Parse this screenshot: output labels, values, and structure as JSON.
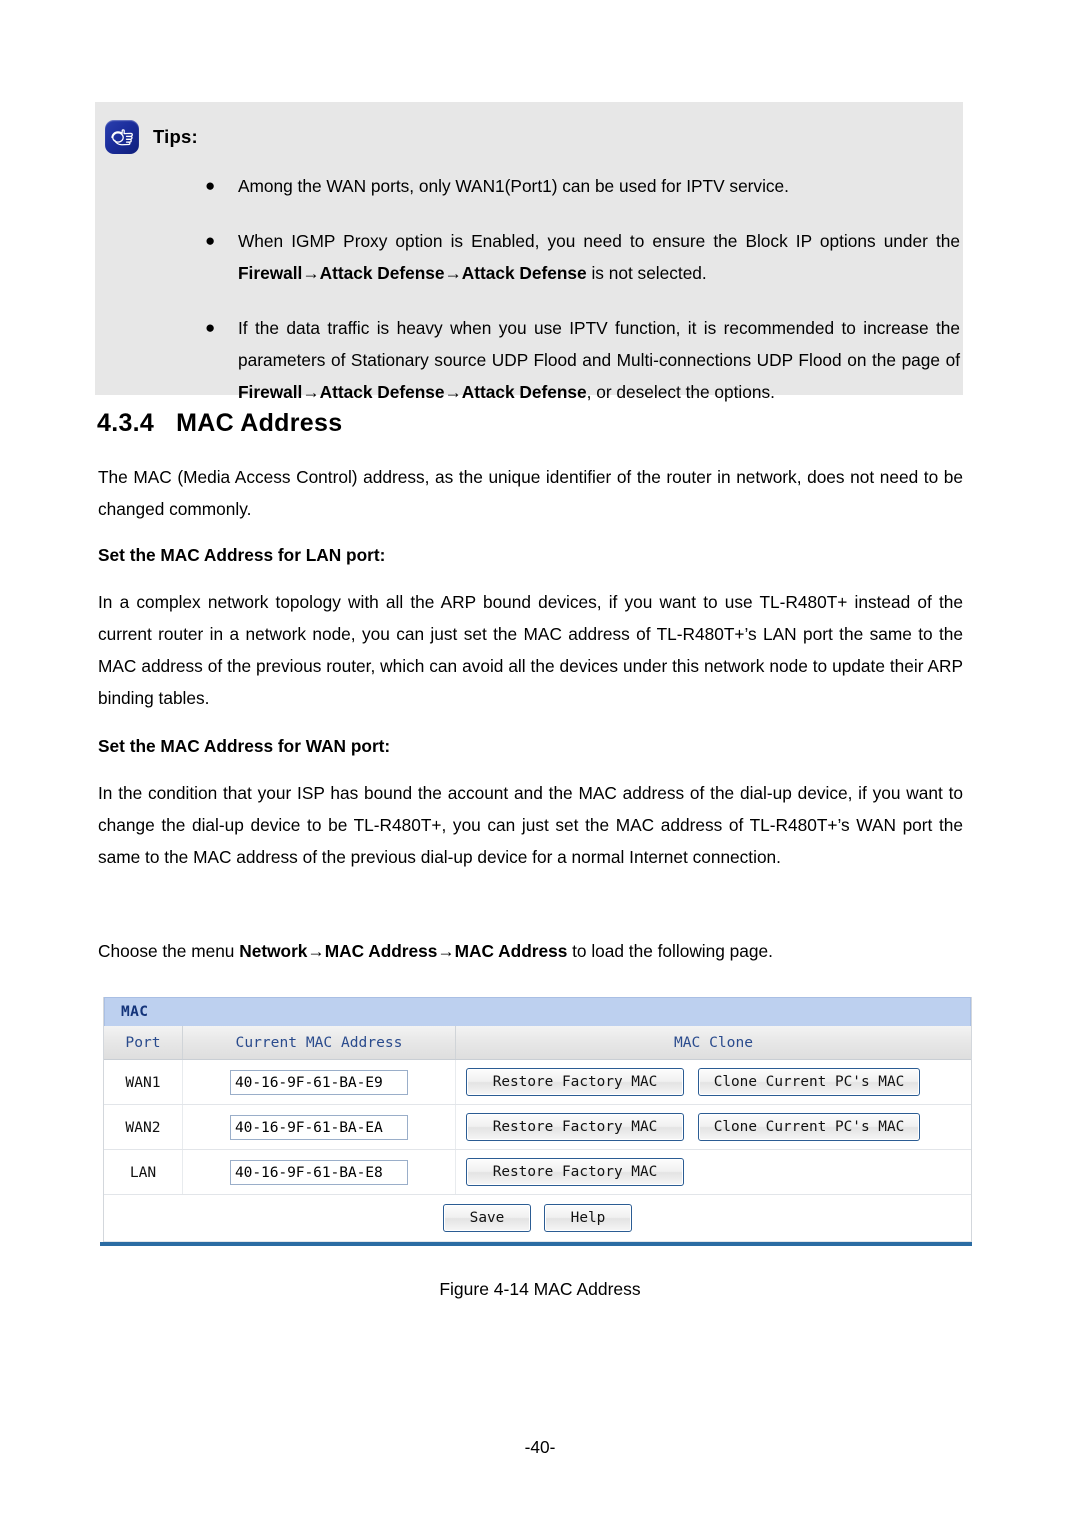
{
  "tips": {
    "icon": "pointing-hand-icon",
    "title": "Tips:",
    "bullet_glyph": "●",
    "items": [
      {
        "pre": "Among the WAN ports, only WAN1(Port1) can be used for IPTV service.",
        "bold": "",
        "post": ""
      },
      {
        "pre": "When IGMP Proxy option is Enabled, you need to ensure the Block IP options under the ",
        "bold": "Firewall→Attack Defense→Attack Defense",
        "post": " is not selected."
      },
      {
        "pre": "If the data traffic is heavy when you use IPTV function, it is recommended to increase the parameters of Stationary source UDP Flood and Multi-connections UDP Flood on the page of ",
        "bold": "Firewall→Attack Defense→Attack Defense",
        "post": ", or deselect the options."
      }
    ]
  },
  "section": {
    "number": "4.3.4",
    "title": "MAC Address"
  },
  "body": {
    "intro": "The MAC (Media Access Control) address, as the unique identifier of the router in network, does not need to be changed commonly.",
    "lan_heading": "Set the MAC Address for LAN port:",
    "lan_paragraph": "In a complex network topology with all the ARP bound devices, if you want to use TL-R480T+ instead of the current router in a network node, you can just set the MAC address of TL-R480T+’s LAN port the same to the MAC address of the previous router, which can avoid all the devices under this network node to update their ARP binding tables.",
    "wan_heading": "Set the MAC Address for WAN port:",
    "wan_paragraph": "In the condition that your ISP has bound the account and the MAC address of the dial-up device, if you want to change the dial-up device to be TL-R480T+, you can just set the MAC address of TL-R480T+’s WAN port the same to the MAC address of the previous dial-up device for a normal Internet connection.",
    "choose_pre": "Choose the menu ",
    "choose_bold": "Network→MAC Address→MAC Address",
    "choose_post": " to load the following page."
  },
  "mac_panel": {
    "title": "MAC",
    "columns": [
      "Port",
      "Current MAC Address",
      "MAC Clone"
    ],
    "rows": [
      {
        "port": "WAN1",
        "mac": "40-16-9F-61-BA-E9",
        "restore_label": "Restore Factory MAC",
        "clone_label": "Clone Current PC's MAC",
        "has_clone": true
      },
      {
        "port": "WAN2",
        "mac": "40-16-9F-61-BA-EA",
        "restore_label": "Restore Factory MAC",
        "clone_label": "Clone Current PC's MAC",
        "has_clone": true
      },
      {
        "port": "LAN",
        "mac": "40-16-9F-61-BA-E8",
        "restore_label": "Restore Factory MAC",
        "clone_label": "",
        "has_clone": false
      }
    ],
    "save_label": "Save",
    "help_label": "Help",
    "colors": {
      "titlebar_bg": "#bdd0ef",
      "titlebar_text": "#14347a",
      "header_text": "#2a4b8d",
      "button_border": "#2b5c93",
      "rule": "#2b6ca3"
    }
  },
  "figure_caption": "Figure 4-14 MAC Address",
  "page_number": "-40-"
}
